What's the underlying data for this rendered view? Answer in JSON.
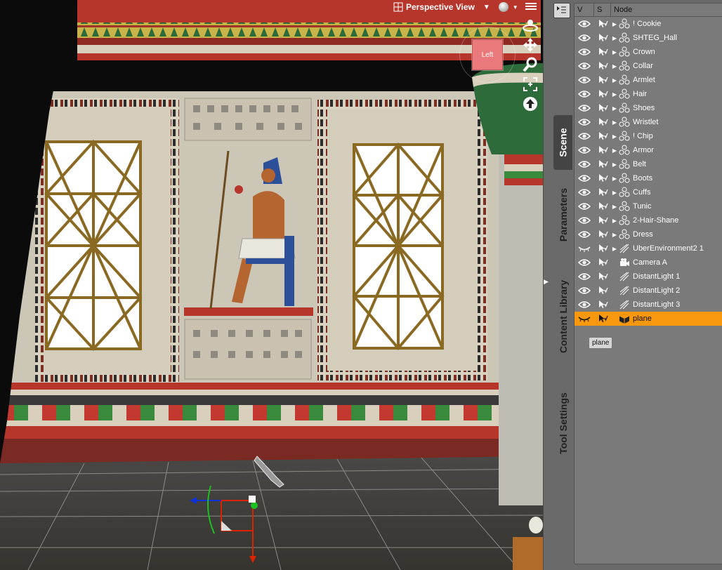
{
  "viewport": {
    "view_label": "Perspective View",
    "view_cube_label": "Left",
    "controls": [
      "orbit-icon",
      "move-icon",
      "zoom-icon",
      "frame-icon",
      "reset-icon"
    ]
  },
  "side_tabs": [
    "Scene",
    "Parameters",
    "Content Library",
    "Tool Settings"
  ],
  "scene": {
    "columns": {
      "v": "V",
      "s": "S",
      "node": "Node"
    },
    "rows": [
      {
        "label": "! Cookie",
        "icon": "figure-icon",
        "expandable": true
      },
      {
        "label": "SHTEG_Hall",
        "icon": "figure-icon",
        "expandable": true
      },
      {
        "label": "Crown",
        "icon": "figure-icon",
        "expandable": true
      },
      {
        "label": "Collar",
        "icon": "figure-icon",
        "expandable": true
      },
      {
        "label": "Armlet",
        "icon": "figure-icon",
        "expandable": true
      },
      {
        "label": "Hair",
        "icon": "figure-icon",
        "expandable": true
      },
      {
        "label": "Shoes",
        "icon": "figure-icon",
        "expandable": true
      },
      {
        "label": "Wristlet",
        "icon": "figure-icon",
        "expandable": true
      },
      {
        "label": "! Chip",
        "icon": "figure-icon",
        "expandable": true
      },
      {
        "label": "Armor",
        "icon": "figure-icon",
        "expandable": true
      },
      {
        "label": "Belt",
        "icon": "figure-icon",
        "expandable": true
      },
      {
        "label": "Boots",
        "icon": "figure-icon",
        "expandable": true
      },
      {
        "label": "Cuffs",
        "icon": "figure-icon",
        "expandable": true
      },
      {
        "label": "Tunic",
        "icon": "figure-icon",
        "expandable": true
      },
      {
        "label": "2-Hair-Shane",
        "icon": "figure-icon",
        "expandable": true
      },
      {
        "label": "Dress",
        "icon": "figure-icon",
        "expandable": true
      },
      {
        "label": "UberEnvironment2 1",
        "icon": "light-icon",
        "expandable": true
      },
      {
        "label": "Camera A",
        "icon": "camera-icon",
        "expandable": false
      },
      {
        "label": "DistantLight 1",
        "icon": "light-icon",
        "expandable": false
      },
      {
        "label": "DistantLight 2",
        "icon": "light-icon",
        "expandable": false
      },
      {
        "label": "DistantLight 3",
        "icon": "light-icon",
        "expandable": false
      },
      {
        "label": "plane",
        "icon": "cube-icon",
        "expandable": false,
        "selected": true
      }
    ],
    "tooltip": "plane"
  },
  "colors": {
    "selection": "#f7980f",
    "panel": "#7a7a7a"
  }
}
